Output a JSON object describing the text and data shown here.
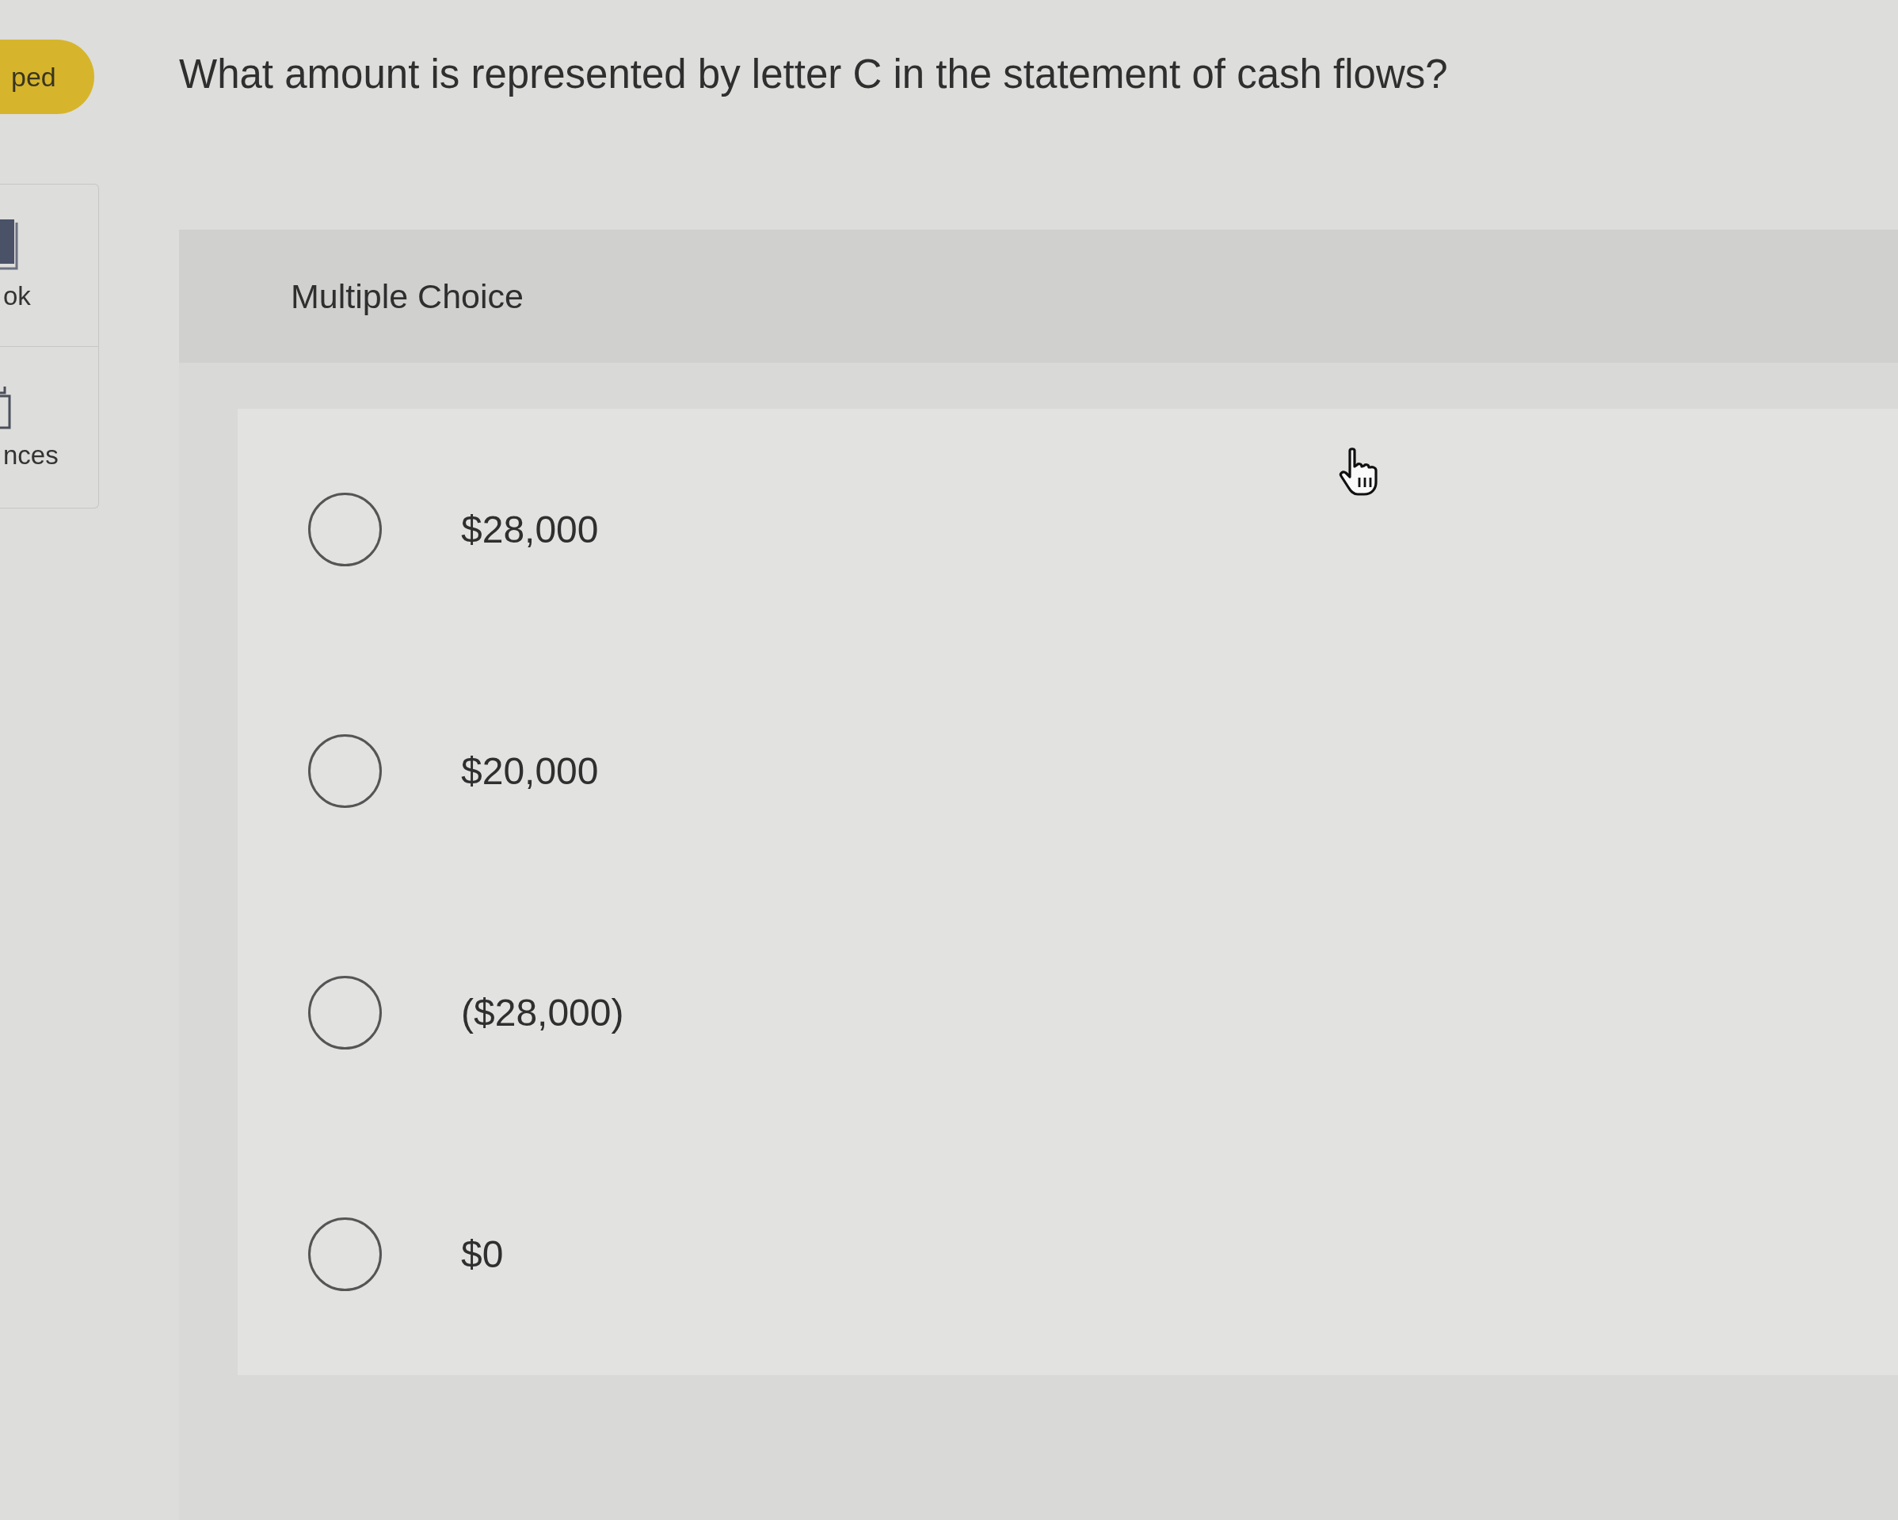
{
  "status_badge": {
    "label": "ped"
  },
  "sidebar": {
    "items": [
      {
        "label": "ok",
        "kind": "book"
      },
      {
        "label": "nces",
        "kind": "clipboard"
      }
    ]
  },
  "question": {
    "text": "What amount is represented by letter C in the statement of cash flows?"
  },
  "answer_panel": {
    "heading": "Multiple Choice",
    "options": [
      {
        "label": "$28,000",
        "selected": false
      },
      {
        "label": "$20,000",
        "selected": false
      },
      {
        "label": "($28,000)",
        "selected": false
      },
      {
        "label": "$0",
        "selected": false
      }
    ]
  }
}
